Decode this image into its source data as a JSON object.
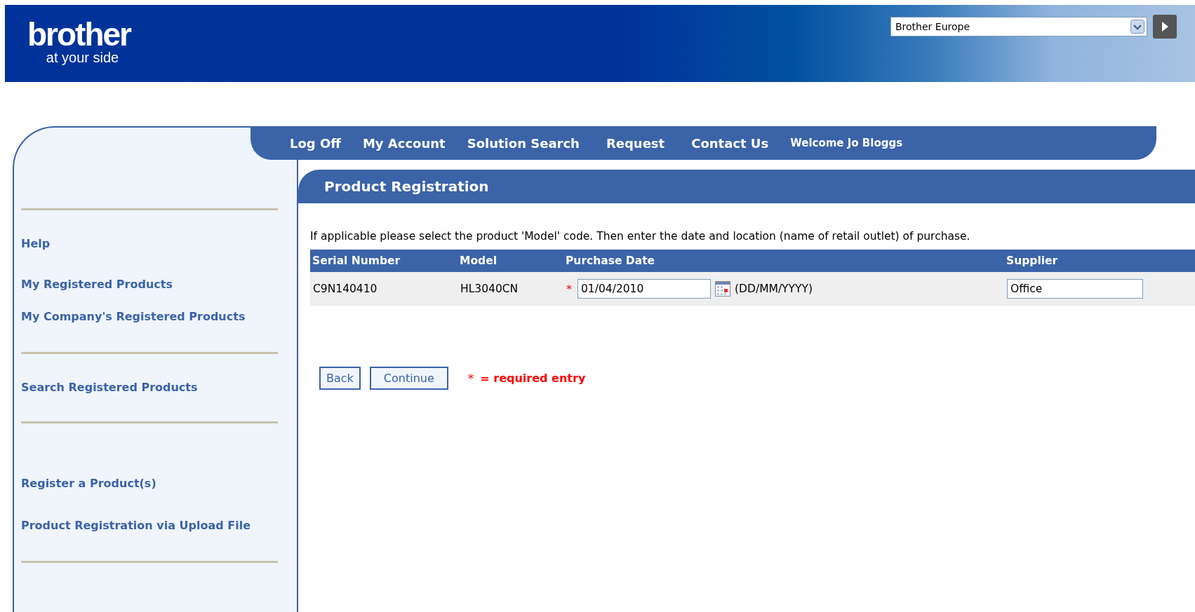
{
  "header": {
    "logo": {
      "wordmark": "brother",
      "tagline": "at your side"
    },
    "region_select": {
      "value": "Brother Europe"
    }
  },
  "nav": {
    "items": [
      "Log Off",
      "My Account",
      "Solution Search",
      "Request",
      "Contact Us"
    ],
    "welcome": "Welcome Jo Bloggs"
  },
  "sidebar": {
    "groups": [
      {
        "items": [
          "Help",
          "My Registered Products",
          "My Company's Registered Products"
        ]
      },
      {
        "items": [
          "Search Registered Products"
        ]
      },
      {
        "items": [
          "Register a Product(s)",
          "Product Registration via Upload File"
        ]
      }
    ]
  },
  "page_title": "Product Registration",
  "instructions": "If applicable please select the product 'Model' code. Then enter the date and location (name of retail outlet) of purchase.",
  "table": {
    "columns": [
      "Serial Number",
      "Model",
      "Purchase Date",
      "Supplier"
    ],
    "rows": [
      {
        "serial": "C9N140410",
        "model": "HL3040CN",
        "required_mark": "*",
        "purchase_date": "01/04/2010",
        "date_format": "(DD/MM/YYYY)",
        "supplier": "Office"
      }
    ]
  },
  "buttons": [
    "Back",
    "Continue"
  ],
  "legend": {
    "mark": "*",
    "text": "= required entry"
  }
}
